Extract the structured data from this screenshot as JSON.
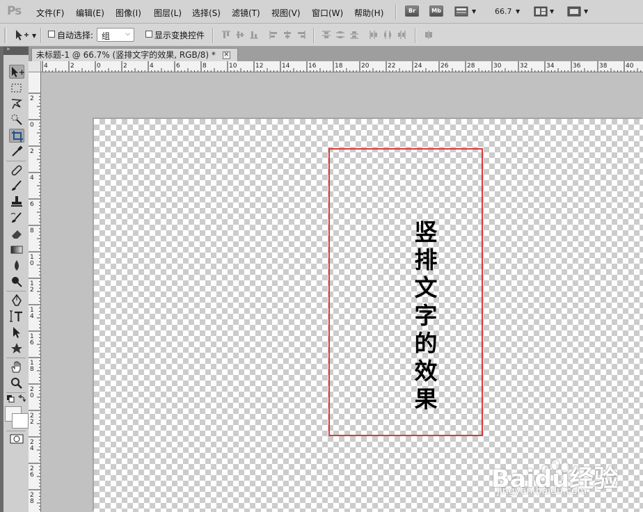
{
  "app": {
    "logo": "Ps"
  },
  "menu": {
    "items": [
      "文件(F)",
      "编辑(E)",
      "图像(I)",
      "图层(L)",
      "选择(S)",
      "滤镜(T)",
      "视图(V)",
      "窗口(W)",
      "帮助(H)"
    ],
    "bridge_label": "Br",
    "mini_bridge_label": "Mb",
    "zoom_value": "66.7"
  },
  "options": {
    "auto_select_label": "自动选择:",
    "auto_select_checked": false,
    "auto_select_target": "组",
    "show_transform_label": "显示变换控件",
    "show_transform_checked": false
  },
  "document": {
    "tab_title": "未标题-1 @ 66.7% (竖排文字的效果, RGB/8) *",
    "close_glyph": "✕",
    "canvas_text": "竖排文字的效果",
    "frame_color": "#d9393b"
  },
  "rulers": {
    "horizontal_ticks": [
      "4",
      "2",
      "0",
      "2",
      "4",
      "6",
      "8",
      "10",
      "12",
      "14",
      "16",
      "18",
      "20",
      "22",
      "24",
      "26",
      "28",
      "30",
      "32",
      "34",
      "36",
      "38",
      "40"
    ],
    "vertical_ticks": [
      "2",
      "0",
      "2",
      "4",
      "6",
      "8",
      "10",
      "12",
      "14",
      "16",
      "18",
      "20",
      "22",
      "24",
      "26",
      "28"
    ]
  },
  "tools": [
    "move-tool-icon",
    "marquee-tool-icon",
    "lasso-tool-icon",
    "quick-select-tool-icon",
    "crop-tool-icon",
    "eyedropper-tool-icon",
    "healing-brush-tool-icon",
    "brush-tool-icon",
    "clone-stamp-tool-icon",
    "history-brush-tool-icon",
    "eraser-tool-icon",
    "gradient-tool-icon",
    "blur-tool-icon",
    "dodge-tool-icon",
    "pen-tool-icon",
    "type-tool-icon",
    "path-select-tool-icon",
    "custom-shape-tool-icon",
    "hand-tool-icon",
    "zoom-tool-icon"
  ],
  "watermark": {
    "text": "Baidu经验",
    "sub": "jingyan.baidu.com"
  }
}
